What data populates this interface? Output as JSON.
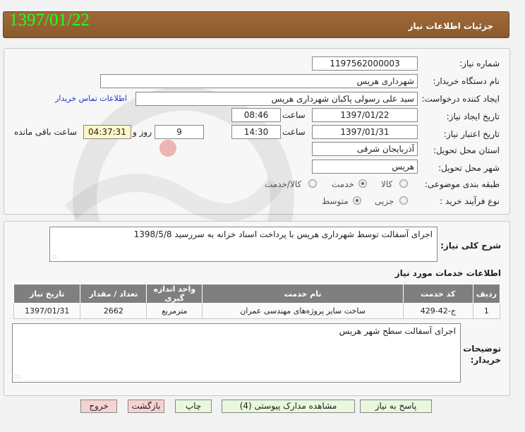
{
  "header": {
    "title": "جزئیات اطلاعات نیاز",
    "date": "1397/01/22"
  },
  "form": {
    "need_number": {
      "label": "شماره نیاز:",
      "value": "1197562000003"
    },
    "buyer": {
      "label": "نام دستگاه خریدار:",
      "value": "شهرداری هریس"
    },
    "requester": {
      "label": "ایجاد کننده درخواست:",
      "value": "سید علی رسولی پاکبان شهرداری هریس",
      "link": "اطلاعات تماس خریدار"
    },
    "created": {
      "label": "تاریخ ایجاد نیاز:",
      "date": "1397/01/22",
      "time_label": "ساعت",
      "time": "08:46"
    },
    "validity": {
      "label": "تاریخ اعتبار نیاز:",
      "date": "1397/01/31",
      "time_label": "ساعت",
      "time": "14:30",
      "days": "9",
      "days_label": "روز و",
      "remaining": "04:37:31",
      "remaining_label": "ساعت باقی مانده"
    },
    "province": {
      "label": "استان محل تحویل:",
      "value": "آذربایجان شرقی"
    },
    "city": {
      "label": "شهر محل تحویل:",
      "value": "هریس"
    },
    "category": {
      "label": "طبقه بندی موضوعی:",
      "options": [
        "کالا",
        "خدمت",
        "کالا/خدمت"
      ],
      "selected": "خدمت"
    },
    "purchase_type": {
      "label": "نوع فرآیند خرید :",
      "options": [
        "جزیی",
        "متوسط"
      ],
      "selected": "متوسط"
    }
  },
  "description": {
    "label": "شرح کلی نیاز:",
    "text": "اجرای آسفالت توسط شهرداری هریس با پرداخت اسناد خزانه به سررسید 1398/5/8"
  },
  "services": {
    "title": "اطلاعات خدمات مورد نیاز",
    "columns": [
      "ردیف",
      "کد خدمت",
      "نام خدمت",
      "واحد اندازه گیری",
      "تعداد / مقدار",
      "تاریخ نیاز"
    ],
    "rows": [
      [
        "1",
        "ج-42-429",
        "ساخت سایر پروژه‌های مهندسی عمران",
        "مترمربع",
        "2662",
        "1397/01/31"
      ]
    ]
  },
  "buyer_notes": {
    "label_line1": "توضیحات",
    "label_line2": "خریدار:",
    "text": "اجرای آسفالت سطح شهر هریس"
  },
  "buttons": {
    "reply": "پاسخ به نیاز",
    "attachments": "مشاهده مدارک پیوستی (4)",
    "print": "چاپ",
    "back": "بازگشت",
    "exit": "خروج"
  },
  "colors": {
    "header_bg": "#9a6533",
    "date_green": "#22ff22",
    "link_blue": "#1a35c9",
    "button_green": "#e9f7dc",
    "button_red": "#f6d2d2",
    "table_header": "#7f7f7f"
  }
}
